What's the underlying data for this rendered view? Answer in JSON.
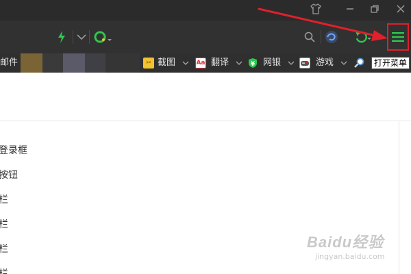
{
  "bookmarks": {
    "mail_label": "邮件",
    "screenshot_label": "截图",
    "translate_label": "翻译",
    "banking_label": "网银",
    "games_label": "游戏"
  },
  "tooltip": {
    "menu_tooltip": "打开菜单"
  },
  "content": {
    "lines": [
      "登录框",
      "按钮",
      "栏",
      "栏",
      "栏",
      "栏"
    ]
  },
  "watermark": {
    "text": "Baidu经验",
    "sub": "jingyan.baidu.com"
  },
  "colors": {
    "titlebar_bg": "#2b2b2b",
    "toolbar_bg": "#313131",
    "bookmarks_bg": "#2f2f2f",
    "accent_green": "#2dc84d",
    "annotation_red": "#e0202a",
    "refresh_blue": "#2f7fd6"
  },
  "icons": {
    "titlebar": [
      "shirt-icon",
      "minimize-icon",
      "restore-icon",
      "close-icon"
    ],
    "toolbar": [
      "lightning-icon",
      "chevron-down-icon",
      "speed-circle-icon",
      "search-icon",
      "swirl-icon",
      "undo-icon",
      "menu-icon"
    ],
    "bookmarks": [
      "screenshot-icon",
      "translate-icon",
      "bank-shield-icon",
      "gamepad-icon",
      "magnifier-icon"
    ]
  }
}
